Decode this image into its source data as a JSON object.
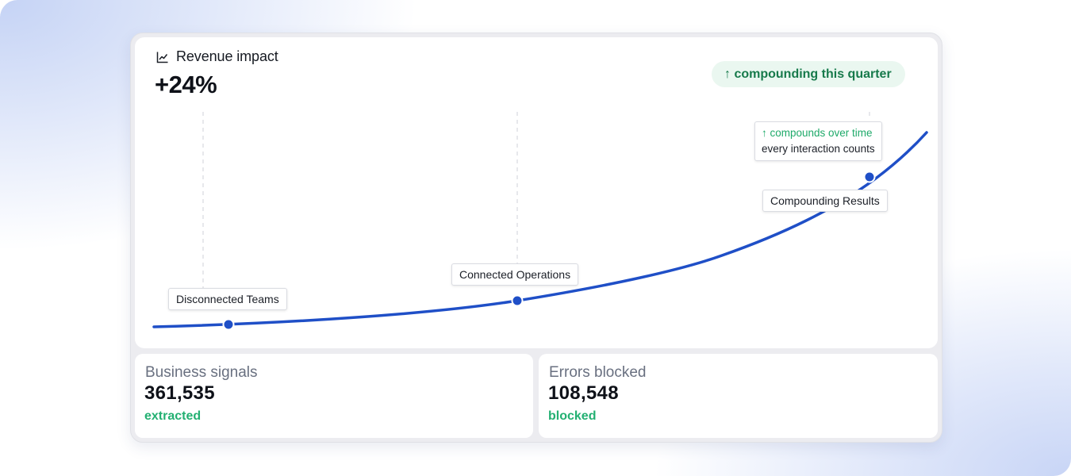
{
  "header": {
    "title": "Revenue impact",
    "icon": "line-chart-icon",
    "value": "+24%",
    "badge": "↑ compounding this quarter",
    "badge_color": "#177a4b"
  },
  "chart": {
    "line_color": "#1f4fc7",
    "labels": {
      "disconnected": "Disconnected Teams",
      "connected": "Connected Operations",
      "compounding": "Compounding Results"
    },
    "note": {
      "line1": "↑ compounds over time",
      "line2": "every interaction counts"
    }
  },
  "cards": [
    {
      "label": "Business signals",
      "value": "361,535",
      "sub": "extracted"
    },
    {
      "label": "Errors blocked",
      "value": "108,548",
      "sub": "blocked"
    }
  ]
}
